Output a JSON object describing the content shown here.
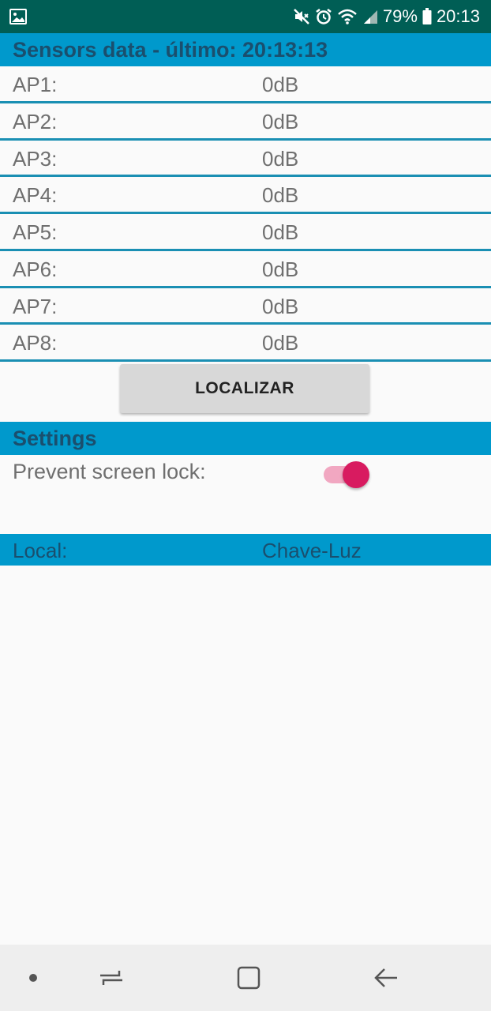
{
  "status_bar": {
    "battery": "79%",
    "time": "20:13",
    "icons": [
      "image-icon",
      "mute-icon",
      "alarm-icon",
      "wifi-icon",
      "signal-icon",
      "battery-icon"
    ]
  },
  "sensors": {
    "header": "Sensors data - último: 20:13:13",
    "rows": [
      {
        "label": "AP1:",
        "value": "0dB"
      },
      {
        "label": "AP2:",
        "value": "0dB"
      },
      {
        "label": "AP3:",
        "value": "0dB"
      },
      {
        "label": "AP4:",
        "value": "0dB"
      },
      {
        "label": "AP5:",
        "value": "0dB"
      },
      {
        "label": "AP6:",
        "value": "0dB"
      },
      {
        "label": "AP7:",
        "value": "0dB"
      },
      {
        "label": "AP8:",
        "value": "0dB"
      }
    ]
  },
  "actions": {
    "localizar_label": "LOCALIZAR"
  },
  "settings": {
    "header": "Settings",
    "prevent_lock_label": "Prevent screen lock:",
    "prevent_lock_enabled": true
  },
  "location": {
    "label": "Local:",
    "value": "Chave-Luz"
  },
  "nav_bar": {
    "icons": [
      "dot-icon",
      "recents-icon",
      "home-icon",
      "back-icon"
    ]
  },
  "colors": {
    "status_bar": "#005e55",
    "header_bg": "#0099cc",
    "header_text": "#1a4f6e",
    "divider": "#1a8fb3",
    "toggle_thumb": "#d81b60",
    "toggle_track": "#f1a7c1"
  }
}
